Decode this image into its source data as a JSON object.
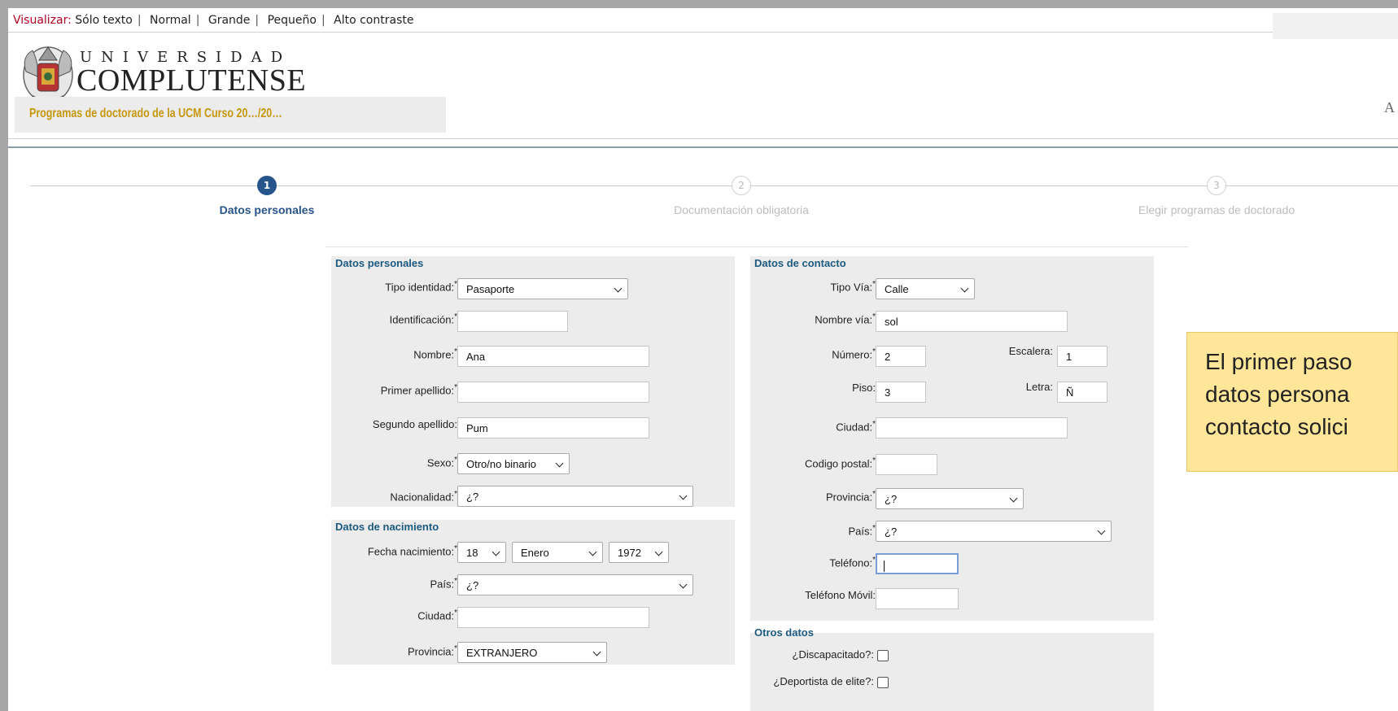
{
  "topbar": {
    "label": "Visualizar:",
    "options": [
      "Sólo texto",
      "Normal",
      "Grande",
      "Pequeño",
      "Alto contraste"
    ]
  },
  "header": {
    "universidad": "UNIVERSIDAD",
    "complutense": "COMPLUTENSE",
    "program": "Programas de doctorado de la UCM Curso 20…/20…",
    "right_char": "A"
  },
  "steps": [
    {
      "number": "1",
      "label": "Datos personales",
      "active": true
    },
    {
      "number": "2",
      "label": "Documentación obligatoria",
      "active": false
    },
    {
      "number": "3",
      "label": "Elegir programas de doctorado",
      "active": false
    }
  ],
  "datos_personales": {
    "title": "Datos personales",
    "tipo_identidad": {
      "label": "Tipo identidad:",
      "value": "Pasaporte"
    },
    "identificacion": {
      "label": "Identificación:",
      "value": ""
    },
    "nombre": {
      "label": "Nombre:",
      "value": "Ana"
    },
    "primer_apellido": {
      "label": "Primer apellido:",
      "value": ""
    },
    "segundo_apellido": {
      "label": "Segundo apellido:",
      "value": "Pum"
    },
    "sexo": {
      "label": "Sexo:",
      "value": "Otro/no binario"
    },
    "nacionalidad": {
      "label": "Nacionalidad:",
      "value": "¿?"
    }
  },
  "datos_nacimiento": {
    "title": "Datos de nacimiento",
    "fecha": {
      "label": "Fecha nacimiento:",
      "day": "18",
      "month": "Enero",
      "year": "1972"
    },
    "pais": {
      "label": "País:",
      "value": "¿?"
    },
    "ciudad": {
      "label": "Ciudad:",
      "value": ""
    },
    "provincia": {
      "label": "Provincia:",
      "value": "EXTRANJERO"
    }
  },
  "datos_contacto": {
    "title": "Datos de contacto",
    "tipo_via": {
      "label": "Tipo Vía:",
      "value": "Calle"
    },
    "nombre_via": {
      "label": "Nombre vía:",
      "value": "sol"
    },
    "numero": {
      "label": "Número:",
      "value": "2"
    },
    "escalera": {
      "label": "Escalera:",
      "value": "1"
    },
    "piso": {
      "label": "Piso:",
      "value": "3"
    },
    "letra": {
      "label": "Letra:",
      "value": "Ñ"
    },
    "ciudad": {
      "label": "Ciudad:",
      "value": ""
    },
    "codigo_postal": {
      "label": "Codigo postal:",
      "value": ""
    },
    "provincia": {
      "label": "Provincia:",
      "value": "¿?"
    },
    "pais": {
      "label": "País:",
      "value": "¿?"
    },
    "telefono": {
      "label": "Teléfono:",
      "value": ""
    },
    "telefono_movil": {
      "label": "Teléfono Móvil:",
      "value": ""
    }
  },
  "otros_datos": {
    "title": "Otros datos",
    "discapacitado": {
      "label": "¿Discapacitado?:",
      "checked": false
    },
    "deportista": {
      "label": "¿Deportista de elite?:",
      "checked": false
    }
  },
  "callout": {
    "lines": [
      "El primer paso",
      "datos persona",
      "contacto solici"
    ]
  },
  "required_mark": "*",
  "colors": {
    "accent": "#27548a",
    "section_title": "#1c5a80",
    "program_text": "#c6970d",
    "callout_bg": "#ffe699"
  }
}
